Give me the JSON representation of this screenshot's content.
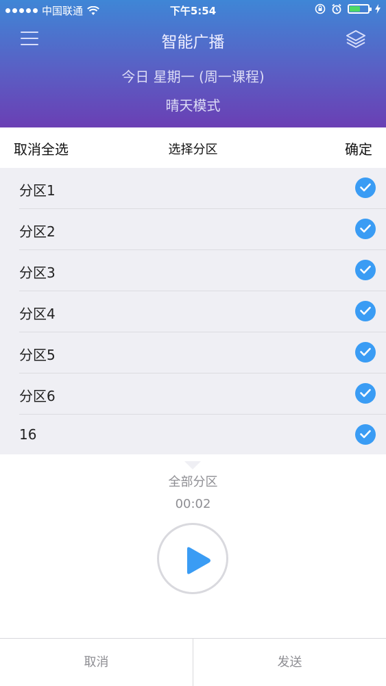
{
  "status_bar": {
    "carrier": "中国联通",
    "time": "下午5:54"
  },
  "header": {
    "title": "智能广播",
    "subtitle_day": "今日 星期一 (周一课程)",
    "subtitle_mode": "晴天模式"
  },
  "sheet": {
    "cancel_all_label": "取消全选",
    "title": "选择分区",
    "confirm_label": "确定"
  },
  "zones": [
    {
      "label": "分区1",
      "checked": true
    },
    {
      "label": "分区2",
      "checked": true
    },
    {
      "label": "分区3",
      "checked": true
    },
    {
      "label": "分区4",
      "checked": true
    },
    {
      "label": "分区5",
      "checked": true
    },
    {
      "label": "分区6",
      "checked": true
    },
    {
      "label": "16",
      "checked": true
    }
  ],
  "player": {
    "zone_label": "全部分区",
    "timer": "00:02"
  },
  "bottom": {
    "cancel_label": "取消",
    "send_label": "发送"
  },
  "colors": {
    "accent": "#3a9cf4",
    "header_top": "#3f86d6",
    "header_bottom": "#6a3fb4"
  }
}
